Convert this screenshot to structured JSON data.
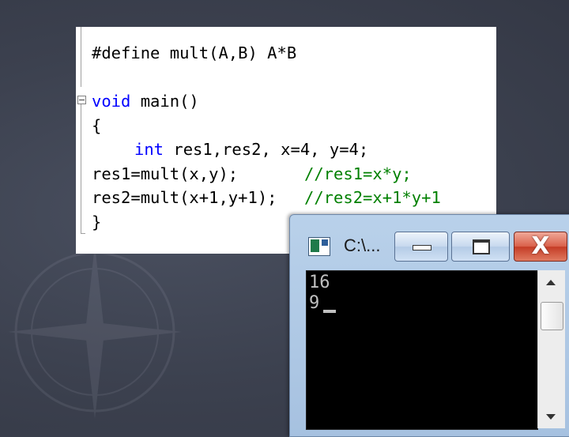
{
  "code": {
    "lines": [
      "#define mult(A,B) A*B",
      "",
      "void main()",
      "{",
      "int res1,res2, x=4, y=4;",
      "res1=mult(x,y);",
      "//res1=x*y;",
      "res2=mult(x+1,y+1);",
      "//res2=x+1*y+1",
      "}"
    ],
    "keywords": {
      "void": "void",
      "int": "int"
    },
    "rest": {
      "main": " main()",
      "decl": " res1,res2, x=4, y=4;"
    }
  },
  "console": {
    "title": "C:\\...",
    "output": [
      "16",
      "9"
    ],
    "buttons": {
      "minimize": "minimize",
      "maximize": "maximize",
      "close": "X"
    }
  },
  "colors": {
    "keyword": "#0000ff",
    "comment": "#008000",
    "console_bg": "#000000",
    "console_text": "#c0c0c0",
    "close_button": "#c43c26"
  }
}
